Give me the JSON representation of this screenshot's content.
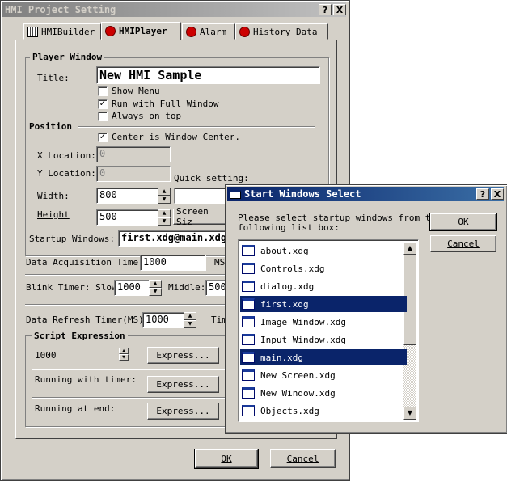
{
  "main_window": {
    "title": "HMI Project Setting",
    "help_btn": "?",
    "close_btn": "X",
    "tabs": [
      {
        "label": "HMIBuilder"
      },
      {
        "label": "HMIPlayer"
      },
      {
        "label": "Alarm"
      },
      {
        "label": "History Data"
      }
    ],
    "player_window": {
      "group_title": "Player Window",
      "title_label": "Title:",
      "title_value": "New HMI Sample",
      "show_menu": {
        "label": "Show Menu",
        "checked": false
      },
      "run_full": {
        "label": "Run with Full Window",
        "checked": true
      },
      "always_top": {
        "label": "Always on top",
        "checked": false
      }
    },
    "position": {
      "title": "Position",
      "center": {
        "label": "Center is Window Center.",
        "checked": true
      },
      "x_label": "X Location:",
      "x_value": "0",
      "y_label": "Y Location:",
      "y_value": "0",
      "quick_setting": "Quick setting:",
      "width_label": "Width:",
      "width_value": "800",
      "height_label": "Height",
      "height_value": "500",
      "screen_size_btn": "Screen Siz"
    },
    "startup_label": "Startup Windows:",
    "startup_value": "first.xdg@main.xdg",
    "data_acq_label": "Data Acquisition Timer:",
    "data_acq_value": "1000",
    "data_acq_unit": "MS",
    "blink_label": "Blink Timer: Slow:",
    "blink_slow": "1000",
    "blink_middle_label": "Middle:",
    "blink_middle": "500",
    "refresh_label": "Data Refresh Timer(MS):",
    "refresh_value": "1000",
    "refresh_trail": "Tim",
    "script": {
      "title": "Script Expression",
      "value": "1000",
      "express_btn": "Express...",
      "timer_label": "Running with timer:",
      "end_label": "Running at end:"
    },
    "ok_btn": "OK",
    "cancel_btn": "Cancel"
  },
  "dialog": {
    "title": "Start Windows Select",
    "help_btn": "?",
    "close_btn": "X",
    "prompt_line1": "Please select startup windows from the",
    "prompt_line2": "following list box:",
    "ok_btn": "OK",
    "cancel_btn": "Cancel",
    "items": [
      {
        "label": "about.xdg",
        "selected": false
      },
      {
        "label": "Controls.xdg",
        "selected": false
      },
      {
        "label": "dialog.xdg",
        "selected": false
      },
      {
        "label": "first.xdg",
        "selected": true
      },
      {
        "label": "Image Window.xdg",
        "selected": false
      },
      {
        "label": "Input Window.xdg",
        "selected": false
      },
      {
        "label": "main.xdg",
        "selected": true
      },
      {
        "label": "New Screen.xdg",
        "selected": false
      },
      {
        "label": "New Window.xdg",
        "selected": false
      },
      {
        "label": "Objects.xdg",
        "selected": false
      }
    ]
  },
  "colors": {
    "face": "#d4d0c8",
    "selection": "#0a246a",
    "title_active": "#0a246a",
    "title_inactive": "#808080"
  }
}
